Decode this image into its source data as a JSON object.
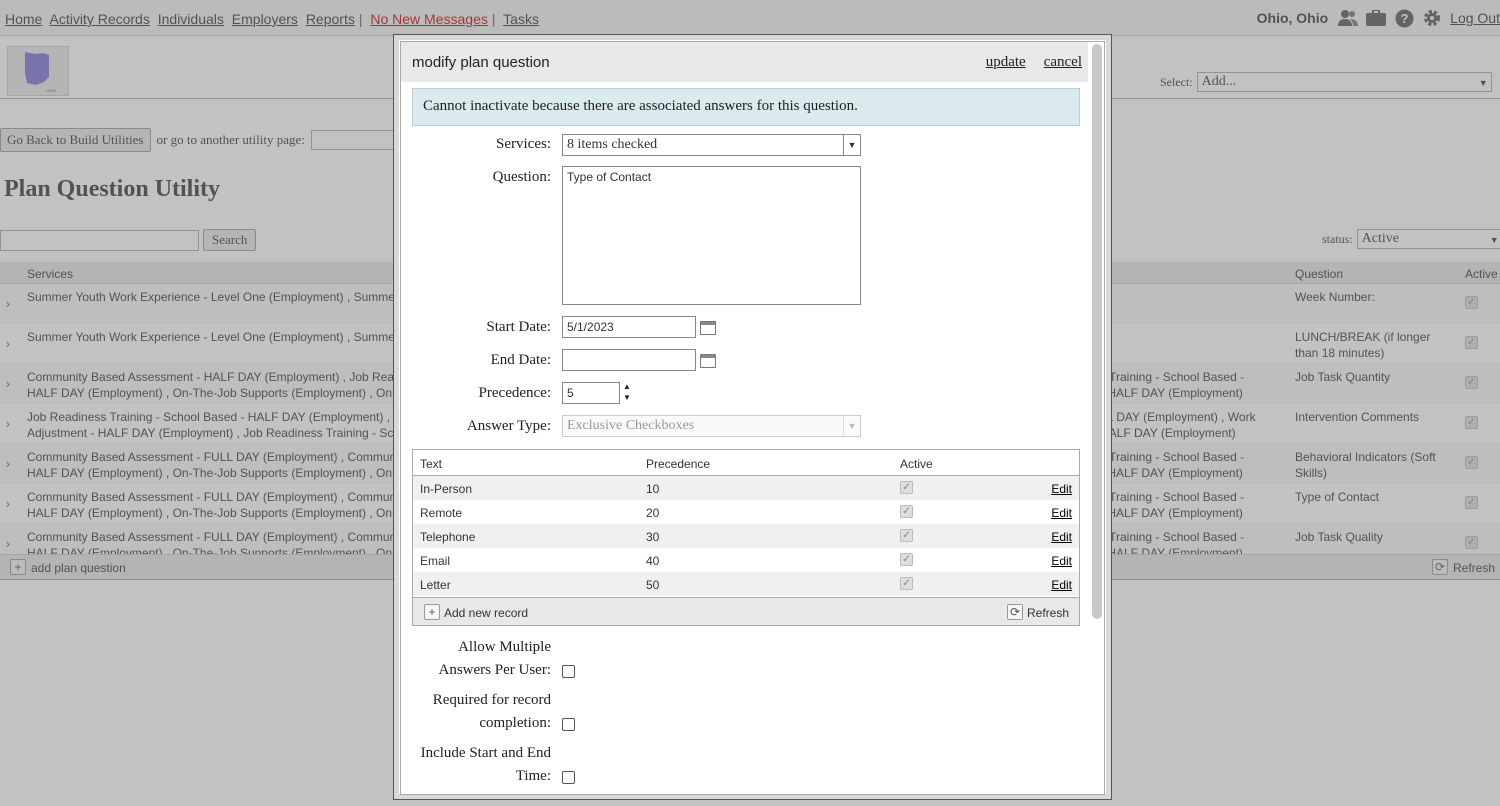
{
  "topnav": {
    "links": [
      {
        "label": "Home"
      },
      {
        "label": "Activity Records"
      },
      {
        "label": "Individuals"
      },
      {
        "label": "Employers"
      },
      {
        "label": "Reports"
      }
    ],
    "messages": "No New Messages",
    "tasks": "Tasks",
    "location": "Ohio, Ohio",
    "logout": "Log Out"
  },
  "header": {
    "select_label": "Select:",
    "select_value": "Add..."
  },
  "util": {
    "back_button": "Go Back to Build Utilities",
    "goto_text": "or go to another utility page:",
    "page_title": "Plan Question Utility",
    "search_button": "Search",
    "status_label": "status:",
    "status_value": "Active"
  },
  "grid": {
    "headers": {
      "services": "Services",
      "question": "Question",
      "active": "Active"
    },
    "rows": [
      {
        "svc_l1": "Summer Youth Work Experience - Level One (Employment) , Summer",
        "svc_l2": "",
        "svc2_l1": "",
        "svc2_l2": "",
        "question": "Week Number:"
      },
      {
        "svc_l1": "Summer Youth Work Experience - Level One (Employment) , Summer",
        "svc_l2": "",
        "svc2_l1": "",
        "svc2_l2": "",
        "question": "LUNCH/BREAK (if longer than 18 minutes)"
      },
      {
        "svc_l1": "Community Based Assessment - HALF DAY (Employment) , Job Read",
        "svc_l2": "HALF DAY (Employment) , On-The-Job Supports (Employment) , On-",
        "svc2_l1": "s Training - School Based -",
        "svc2_l2": "- HALF DAY (Employment)",
        "question": "Job Task Quantity"
      },
      {
        "svc_l1": "Job Readiness Training - School Based - HALF DAY (Employment) , C",
        "svc_l2": "Adjustment - HALF DAY (Employment) , Job Readiness Training - Sch",
        "svc2_l1": "LL DAY (Employment) , Work",
        "svc2_l2": "HALF DAY (Employment)",
        "question": "Intervention Comments"
      },
      {
        "svc_l1": "Community Based Assessment - FULL DAY (Employment) , Commun",
        "svc_l2": "HALF DAY (Employment) , On-The-Job Supports (Employment) , On-",
        "svc2_l1": "s Training - School Based -",
        "svc2_l2": "- HALF DAY (Employment)",
        "question": "Behavioral Indicators (Soft Skills)"
      },
      {
        "svc_l1": "Community Based Assessment - FULL DAY (Employment) , Commun",
        "svc_l2": "HALF DAY (Employment) , On-The-Job Supports (Employment) , On-",
        "svc2_l1": "s Training - School Based -",
        "svc2_l2": "- HALF DAY (Employment)",
        "question": "Type of Contact"
      },
      {
        "svc_l1": "Community Based Assessment - FULL DAY (Employment) , Commun",
        "svc_l2": "HALF DAY (Employment) , On-The-Job Supports (Employment) , On-",
        "svc2_l1": "s Training - School Based -",
        "svc2_l2": "- HALF DAY (Employment)",
        "question": "Job Task Quality"
      }
    ],
    "add_label": "add plan question",
    "refresh_label": "Refresh"
  },
  "dialog": {
    "title": "modify plan question",
    "update": "update",
    "cancel": "cancel",
    "notice": "Cannot inactivate because there are associated answers for this question.",
    "services_label": "Services:",
    "services_value": "8 items checked",
    "question_label": "Question:",
    "question_value": "Type of Contact",
    "start_label": "Start Date:",
    "start_value": "5/1/2023",
    "end_label": "End Date:",
    "end_value": "",
    "precedence_label": "Precedence:",
    "precedence_value": "5",
    "answer_type_label": "Answer Type:",
    "answer_type_value": "Exclusive Checkboxes",
    "answers": {
      "headers": {
        "text": "Text",
        "precedence": "Precedence",
        "active": "Active"
      },
      "rows": [
        {
          "text": "In-Person",
          "precedence": "10",
          "edit": "Edit"
        },
        {
          "text": "Remote",
          "precedence": "20",
          "edit": "Edit"
        },
        {
          "text": "Telephone",
          "precedence": "30",
          "edit": "Edit"
        },
        {
          "text": "Email",
          "precedence": "40",
          "edit": "Edit"
        },
        {
          "text": "Letter",
          "precedence": "50",
          "edit": "Edit"
        }
      ],
      "add_label": "Add new record",
      "refresh_label": "Refresh"
    },
    "allow_multiple_l1": "Allow Multiple",
    "allow_multiple_l2": "Answers Per User:",
    "required_l1": "Required for record",
    "required_l2": "completion:",
    "include_time_l1": "Include Start and End",
    "include_time_l2": "Time:"
  }
}
